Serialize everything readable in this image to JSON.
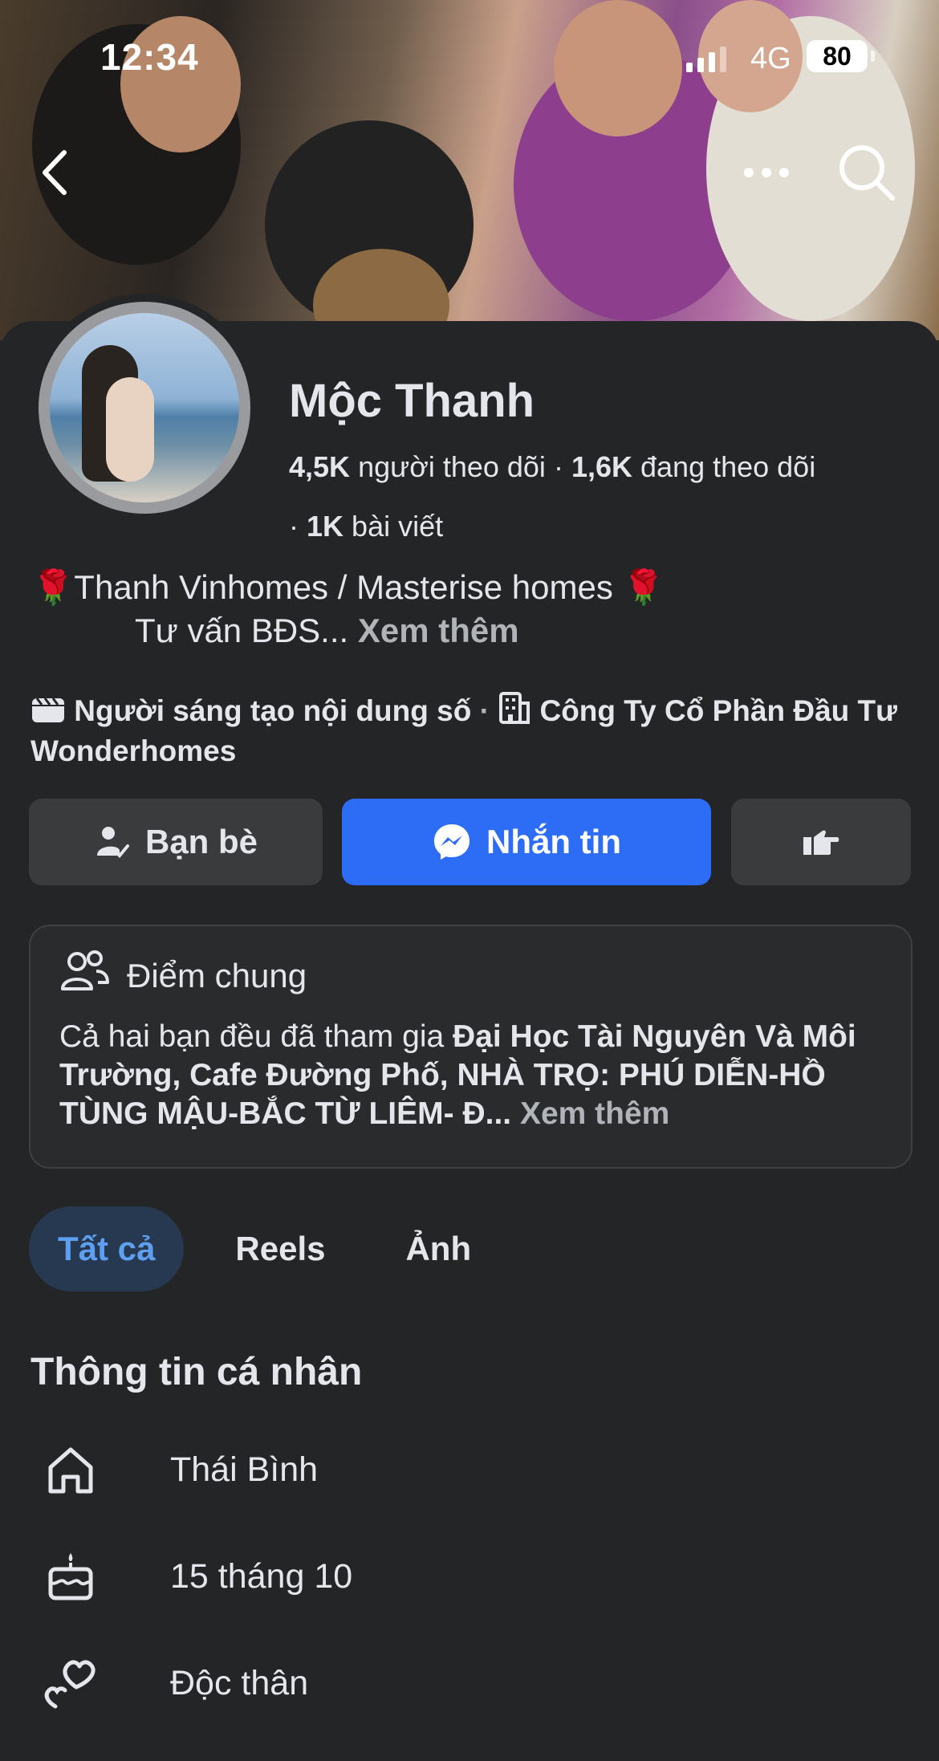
{
  "status_bar": {
    "time": "12:34",
    "network": "4G",
    "battery": "80"
  },
  "profile": {
    "name": "Mộc Thanh",
    "followers_count": "4,5K",
    "followers_label": "người theo dõi",
    "following_count": "1,6K",
    "following_label": "đang theo dõi",
    "posts_count": "1K",
    "posts_label": "bài viết"
  },
  "bio": {
    "line1": "🌹Thanh Vinhomes /  Masterise homes  🌹",
    "line2": "Tư vấn BĐS...",
    "see_more": "Xem thêm"
  },
  "meta": {
    "category": "Người sáng tạo nội dung số",
    "separator": "·",
    "workplace": "Công Ty Cổ Phần Đầu Tư Wonderhomes"
  },
  "actions": {
    "friends_label": "Bạn bè",
    "message_label": "Nhắn tin"
  },
  "mutual": {
    "title": "Điểm chung",
    "prefix": "Cả hai bạn đều đã tham gia ",
    "groups": "Đại Học Tài Nguyên Và Môi Trường, Cafe Đường Phố, NHÀ TRỌ: PHÚ DIỄN-HỒ TÙNG MẬU-BẮC TỪ LIÊM- Đ...",
    "see_more": "Xem thêm"
  },
  "tabs": [
    {
      "label": "Tất cả",
      "active": true
    },
    {
      "label": "Reels",
      "active": false
    },
    {
      "label": "Ảnh",
      "active": false
    }
  ],
  "personal_info": {
    "title": "Thông tin cá nhân",
    "hometown": "Thái Bình",
    "birthday": "15 tháng 10",
    "relationship": "Độc thân"
  },
  "colors": {
    "background": "#242526",
    "primary_button": "#2d6cf5",
    "secondary_button": "#3a3b3c",
    "active_tab_bg": "#263951",
    "active_tab_text": "#5e9ff0"
  }
}
